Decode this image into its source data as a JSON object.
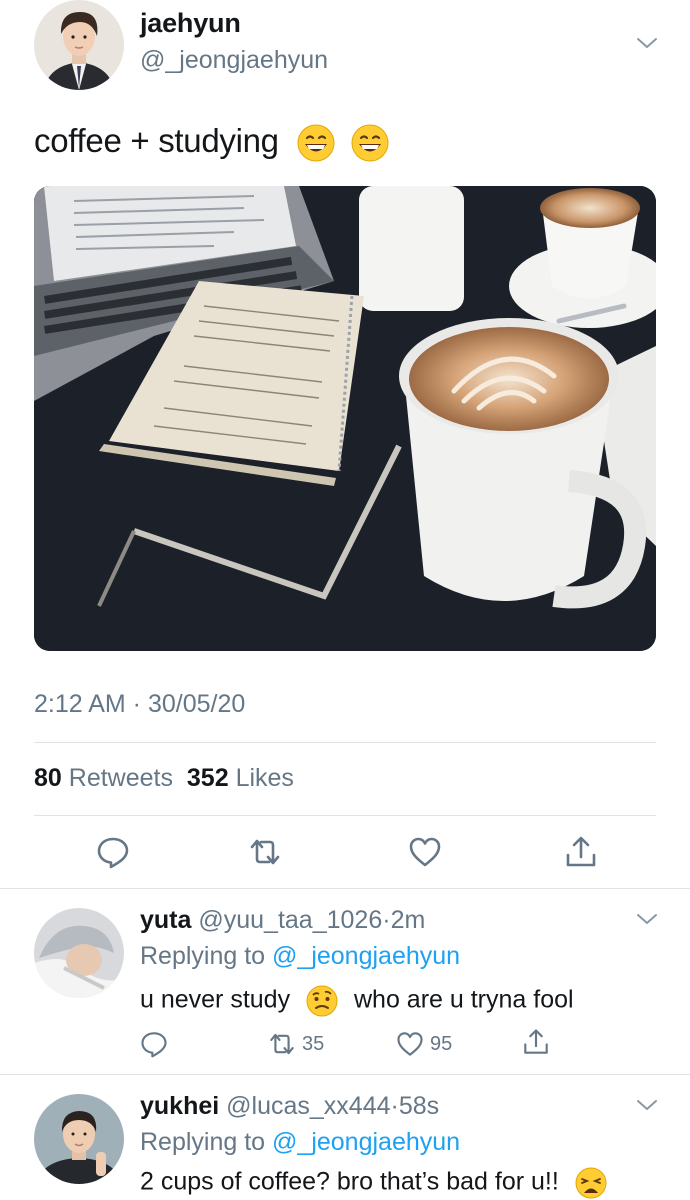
{
  "tweet": {
    "author": {
      "name": "jaehyun",
      "handle": "@_jeongjaehyun"
    },
    "text": "coffee + studying",
    "emojis": [
      "grinning-face-emoji",
      "grinning-face-emoji"
    ],
    "photo": "coffee-and-notebook-photo",
    "timestamp": "2:12 AM · 30/05/20",
    "stats": {
      "retweets_count": "80",
      "retweets_label": "Retweets",
      "likes_count": "352",
      "likes_label": "Likes"
    },
    "actions": [
      "reply-icon",
      "retweet-icon",
      "like-icon",
      "share-icon"
    ]
  },
  "replies": [
    {
      "name": "yuta",
      "handle": "@yuu_taa_1026",
      "sep": "·",
      "time": "2m",
      "replying_prefix": "Replying to",
      "replying_to": "@_jeongjaehyun",
      "text_before": "u never study",
      "emoji": "confused-face-emoji",
      "text_after": "who are u tryna fool",
      "retweets": "35",
      "likes": "95"
    },
    {
      "name": "yukhei",
      "handle": "@lucas_xx444",
      "sep": "·",
      "time": "58s",
      "replying_prefix": "Replying to",
      "replying_to": "@_jeongjaehyun",
      "text_before": "2 cups of coffee? bro that’s bad for u!!",
      "emoji": "weary-face-emoji",
      "text_after": ""
    }
  ],
  "colors": {
    "accent": "#1da1f2",
    "secondary_text": "#657786",
    "primary_text": "#14171a",
    "divider": "#dfe3e7"
  }
}
